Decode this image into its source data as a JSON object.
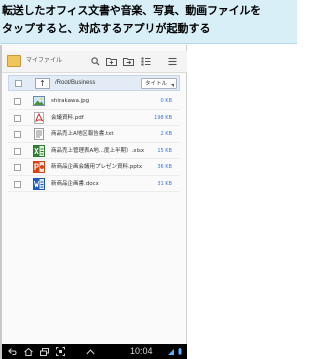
{
  "caption": {
    "line1": "転送したオフィス文書や音楽、写真、動画ファイルを",
    "line2": "タップすると、対応するアプリが起動する"
  },
  "app": {
    "title": "マイファイル",
    "icons": [
      "folder-icon",
      "search-icon",
      "new-folder-icon",
      "move-icon",
      "list-view-icon",
      "menu-icon"
    ]
  },
  "pathbar": {
    "path": "/Root/Business",
    "sort_label": "タイトル",
    "up_glyph": "↑"
  },
  "files": [
    {
      "name": "shirakawa.jpg",
      "size": "0 KB",
      "icon": "image-icon",
      "color": "#4f8f3a"
    },
    {
      "name": "会議資料.pdf",
      "size": "198 KB",
      "icon": "pdf-icon",
      "color": "#d32f2f"
    },
    {
      "name": "商品売上A地区報告書.txt",
      "size": "2 KB",
      "icon": "text-file-icon",
      "color": "#888888"
    },
    {
      "name": "商品売上管理表A地...度上半期）.xlsx",
      "size": "15 KB",
      "icon": "excel-icon",
      "color": "#2e7d32"
    },
    {
      "name": "新商品企画会議用プレゼン資料.pptx",
      "size": "36 KB",
      "icon": "powerpoint-icon",
      "color": "#d84315"
    },
    {
      "name": "新商品企画書.docx",
      "size": "31 KB",
      "icon": "word-icon",
      "color": "#1e5bb8"
    }
  ],
  "system": {
    "clock": "10:04",
    "nav_icons": [
      "back-icon",
      "home-icon",
      "recent-apps-icon",
      "screenshot-icon",
      "up-arrow-icon"
    ]
  }
}
